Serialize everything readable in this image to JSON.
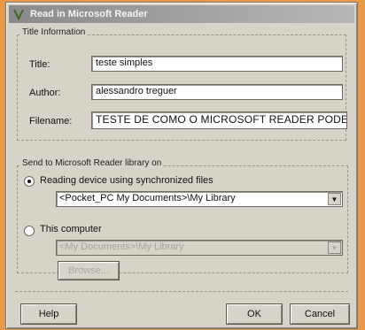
{
  "window": {
    "title": "Read in Microsoft Reader"
  },
  "title_info": {
    "group_label": "Title Information",
    "title_label": "Title:",
    "title_value": "teste simples",
    "author_label": "Author:",
    "author_value": "alessandro treguer",
    "filename_label": "Filename:",
    "filename_value": "TESTE DE COMO O MICROSOFT READER PODE DIMINUI"
  },
  "send_to": {
    "group_label": "Send to Microsoft Reader library on",
    "device_option_label": "Reading device using synchronized files",
    "device_path_value": "<Pocket_PC My Documents>\\My Library",
    "computer_option_label": "This computer",
    "computer_path_value": "<My Documents>\\My Library",
    "browse_label": "Browse..."
  },
  "buttons": {
    "help": "Help",
    "ok": "OK",
    "cancel": "Cancel"
  }
}
